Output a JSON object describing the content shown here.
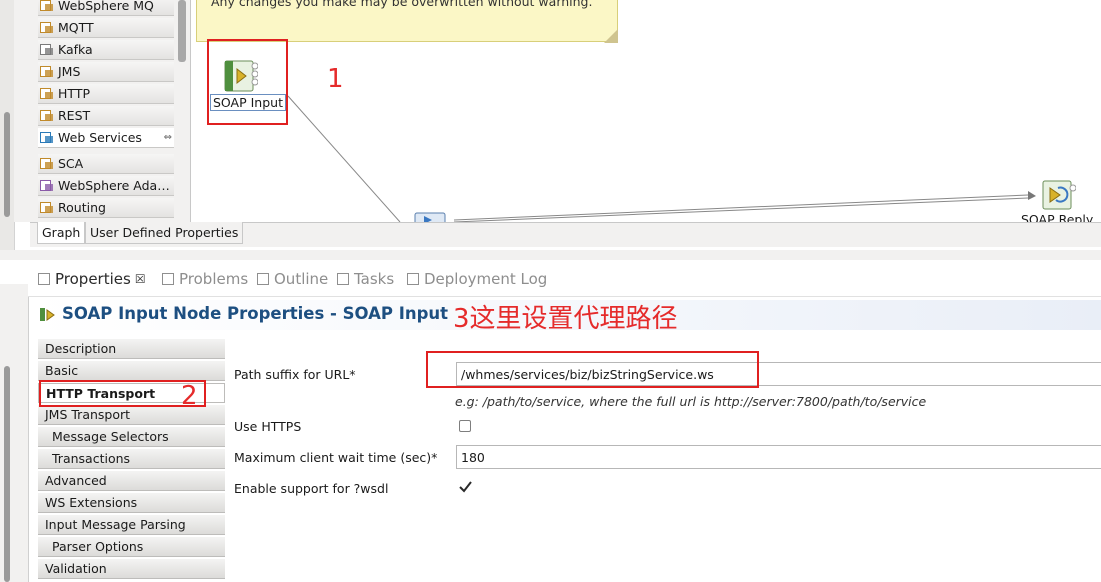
{
  "palette": {
    "items": [
      {
        "label": "WebSphere MQ",
        "icon": "websphere-mq-icon",
        "color": "#c08a2a"
      },
      {
        "label": "MQTT",
        "icon": "mqtt-icon",
        "color": "#c08a2a"
      },
      {
        "label": "Kafka",
        "icon": "kafka-icon",
        "color": "#7a7a7a"
      },
      {
        "label": "JMS",
        "icon": "jms-icon",
        "color": "#c08a2a"
      },
      {
        "label": "HTTP",
        "icon": "http-icon",
        "color": "#c08a2a"
      },
      {
        "label": "REST",
        "icon": "rest-icon",
        "color": "#c08a2a"
      },
      {
        "label": "Web Services",
        "icon": "web-services-icon",
        "color": "#2a7ab8"
      },
      {
        "label": "SCA",
        "icon": "sca-icon",
        "color": "#c08a2a"
      },
      {
        "label": "WebSphere Ada…",
        "icon": "websphere-adapters-icon",
        "color": "#8a5aa8"
      },
      {
        "label": "Routing",
        "icon": "routing-icon",
        "color": "#c08a2a"
      }
    ]
  },
  "canvas": {
    "note_text": "Any changes you make may be overwritten without warning.",
    "soap_input_label": "SOAP Input",
    "soap_reply_label": "SOAP Reply"
  },
  "editor_tabs": [
    "Graph",
    "User Defined Properties"
  ],
  "view_tabs": [
    {
      "label": "Properties",
      "icon": "properties-icon",
      "active": true
    },
    {
      "label": "Problems",
      "icon": "problems-icon"
    },
    {
      "label": "Outline",
      "icon": "outline-icon"
    },
    {
      "label": "Tasks",
      "icon": "tasks-icon"
    },
    {
      "label": "Deployment Log",
      "icon": "deployment-log-icon"
    }
  ],
  "properties": {
    "title": "SOAP Input Node Properties - SOAP Input",
    "sections": [
      {
        "label": "Description"
      },
      {
        "label": "Basic"
      },
      {
        "label": "HTTP Transport",
        "selected": true
      },
      {
        "label": "JMS Transport"
      },
      {
        "label": "Message Selectors",
        "indent": true
      },
      {
        "label": "Transactions",
        "indent": true
      },
      {
        "label": "Advanced"
      },
      {
        "label": "WS Extensions"
      },
      {
        "label": "Input Message Parsing"
      },
      {
        "label": "Parser Options",
        "indent": true
      },
      {
        "label": "Validation"
      }
    ],
    "fields": {
      "path_suffix_label": "Path suffix for URL*",
      "path_suffix_value": "/whmes/services/biz/bizStringService.ws",
      "hint": "e.g: /path/to/service, where the full url is http://server:7800/path/to/service",
      "use_https_label": "Use HTTPS",
      "use_https_checked": false,
      "max_wait_label": "Maximum client wait time (sec)*",
      "max_wait_value": "180",
      "wsdl_label": "Enable support for ?wsdl",
      "wsdl_checked": true
    }
  },
  "annotations": {
    "one": "1",
    "two": "2",
    "three": "3这里设置代理路径",
    "color": "#e02020"
  }
}
